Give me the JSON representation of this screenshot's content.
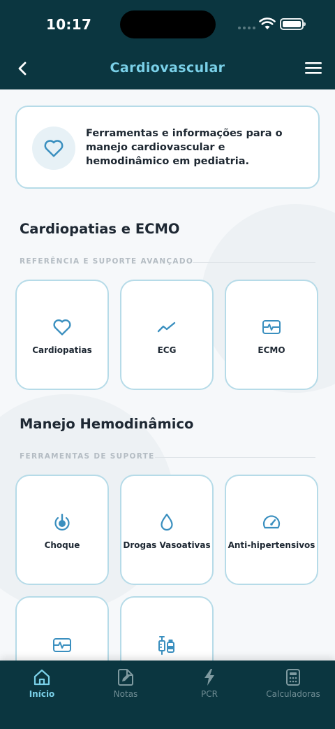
{
  "status_bar": {
    "time": "10:17"
  },
  "header": {
    "title": "Cardiovascular",
    "back_icon": "chevron-left-icon",
    "menu_icon": "hamburger-menu-icon"
  },
  "info_card": {
    "icon": "heart-icon",
    "text": "Ferramentas e informações para o manejo cardiovascular e hemodinâmico em pediatria."
  },
  "sections": [
    {
      "title": "Cardiopatias e ECMO",
      "subtitle": "REFERÊNCIA E SUPORTE AVANÇADO",
      "tiles": [
        {
          "label": "Cardiopatias",
          "icon": "heart-icon"
        },
        {
          "label": "ECG",
          "icon": "trend-line-icon"
        },
        {
          "label": "ECMO",
          "icon": "monitor-pulse-icon"
        }
      ]
    },
    {
      "title": "Manejo Hemodinâmico",
      "subtitle": "FERRAMENTAS DE SUPORTE",
      "tiles": [
        {
          "label": "Choque",
          "icon": "power-target-icon"
        },
        {
          "label": "Drogas Vasoativas",
          "icon": "droplet-icon"
        },
        {
          "label": "Anti-hipertensivos",
          "icon": "gauge-icon"
        },
        {
          "label": "",
          "icon": "monitor-pulse-icon"
        },
        {
          "label": "",
          "icon": "syringe-vial-icon"
        }
      ]
    }
  ],
  "bottom_nav": [
    {
      "label": "Início",
      "icon": "home-icon",
      "active": true
    },
    {
      "label": "Notas",
      "icon": "note-edit-icon",
      "active": false
    },
    {
      "label": "PCR",
      "icon": "lightning-icon",
      "active": false
    },
    {
      "label": "Calculadoras",
      "icon": "calculator-icon",
      "active": false
    }
  ],
  "colors": {
    "header_bg": "#0b3640",
    "accent": "#7ad0e8",
    "icon": "#3a8fbf",
    "tile_border": "#b6dbe8"
  }
}
